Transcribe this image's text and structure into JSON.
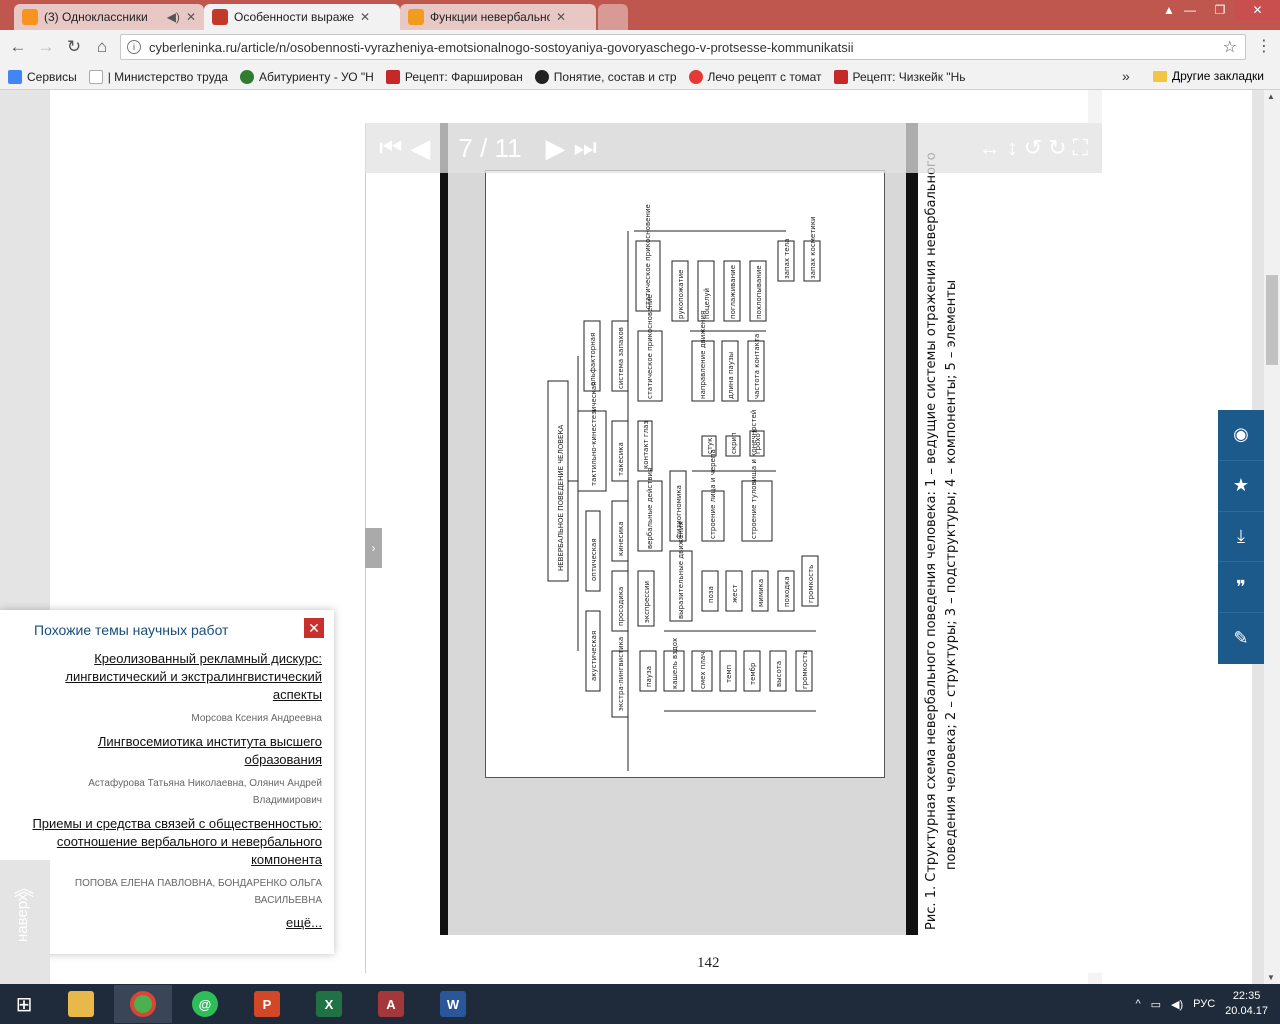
{
  "browser": {
    "tabs": [
      {
        "title": "(3) Одноклассники",
        "icon_color": "#f7931e",
        "icon": "ok-icon"
      },
      {
        "title": "Особенности выражени",
        "icon_color": "#c0392b",
        "icon": "cyberleninka-icon",
        "active": true
      },
      {
        "title": "Функции невербальног",
        "icon_color": "#f29c1f",
        "icon": "thumbs-icon"
      }
    ],
    "url": "cyberleninka.ru/article/n/osobennosti-vyrazheniya-emotsionalnogo-sostoyaniya-govoryaschego-v-protsesse-kommunikatsii",
    "bookmarks": [
      {
        "label": "Сервисы",
        "icon_color": "#4285f4"
      },
      {
        "label": "| Министерство труда",
        "icon_color": "#ddd"
      },
      {
        "label": "Абитуриенту - УО \"Н",
        "icon_color": "#2e7d32"
      },
      {
        "label": "Рецепт: Фарширован",
        "icon_color": "#c62828"
      },
      {
        "label": "Понятие, состав и стр",
        "icon_color": "#222"
      },
      {
        "label": "Лечо рецепт с томат",
        "icon_color": "#e53935"
      },
      {
        "label": "Рецепт: Чизкейк \"Нь",
        "icon_color": "#c62828"
      }
    ],
    "bookmarks_other": "Другие закладки"
  },
  "viewer": {
    "page_current": "7",
    "page_total": "/ 11",
    "page_footer": "142"
  },
  "scan": {
    "caption_line1": "Рис. 1.   Структурная схема невербального поведения человека: 1 – ведущие системы отражения невербального",
    "caption_line2": "поведения человека; 2 – структуры; 3 – подструктуры; 4 – компоненты; 5 – элементы",
    "diagram_title": "НЕВЕРБАЛЬНОЕ ПОВЕДЕНИЕ ЧЕЛОВЕКА",
    "level1": [
      "акустическая",
      "оптическая",
      "тактильно-кинестезическая",
      "ольфакторная"
    ],
    "level2": [
      "экстра-лингвистика",
      "просодика",
      "кинесика",
      "такесика",
      "система запахов"
    ],
    "level3": [
      "экспрессии",
      "вербальные действия",
      "контакт глаз",
      "статическое прикосновение",
      "статическое прикосновение"
    ],
    "level4": [
      "выразительные движения",
      "физиогномика"
    ],
    "level5a": [
      "пауза",
      "кашель вздох",
      "смех плач",
      "темп",
      "тембр",
      "высота",
      "громкость"
    ],
    "level5b": [
      "поза",
      "жест",
      "мимика",
      "походка",
      "громкость"
    ],
    "level5c": [
      "строение лица и черепа",
      "строение туловища и конечностей"
    ],
    "level5d": [
      "стук",
      "скрип",
      "грохот"
    ],
    "level5e": [
      "направление движения",
      "длина паузы",
      "частота контакта"
    ],
    "level5f": [
      "рукопожатие",
      "поцелуй",
      "поглаживание",
      "похлопывание"
    ],
    "level5g": [
      "запах тела",
      "запах косметики"
    ]
  },
  "similar": {
    "heading": "Похожие темы научных работ",
    "items": [
      {
        "title": "Креолизованный рекламный дискурс: лингвистический и экстралингвистический аспекты",
        "authors": "Морсова Ксения Андреевна"
      },
      {
        "title": "Лингвосемиотика института высшего образования",
        "authors": "Астафурова Татьяна Николаевна, Олянич Андрей Владимирович"
      },
      {
        "title": "Приемы и средства связей с общественностью: соотношение вербального и невербального компонента",
        "authors": "ПОПОВА ЕЛЕНА ПАВЛОВНА, БОНДАРЕНКО ОЛЬГА ВАСИЛЬЕВНА"
      }
    ],
    "more": "ещё..."
  },
  "naverh": "наверх",
  "taskbar": {
    "lang": "РУС",
    "time": "22:35",
    "date": "20.04.17"
  }
}
